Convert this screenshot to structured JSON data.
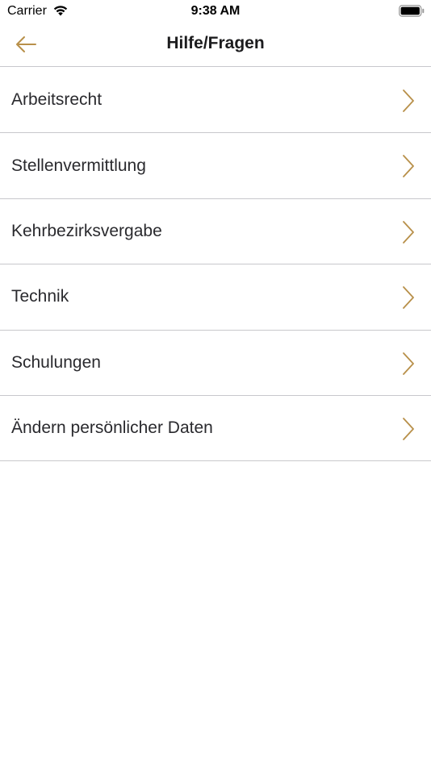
{
  "status_bar": {
    "carrier": "Carrier",
    "time": "9:38 AM",
    "wifi_icon": "wifi-icon",
    "battery_icon": "battery-icon"
  },
  "nav": {
    "title": "Hilfe/Fragen",
    "back_icon": "arrow-left-icon"
  },
  "colors": {
    "accent": "#b8904a",
    "separator": "#c8c8cc",
    "text": "#2a2a2e"
  },
  "list": {
    "items": [
      {
        "label": "Arbeitsrecht"
      },
      {
        "label": "Stellenvermittlung"
      },
      {
        "label": "Kehrbezirksvergabe"
      },
      {
        "label": "Technik"
      },
      {
        "label": "Schulungen"
      },
      {
        "label": "Ändern persönlicher Daten"
      }
    ],
    "chevron_icon": "chevron-right-icon"
  }
}
